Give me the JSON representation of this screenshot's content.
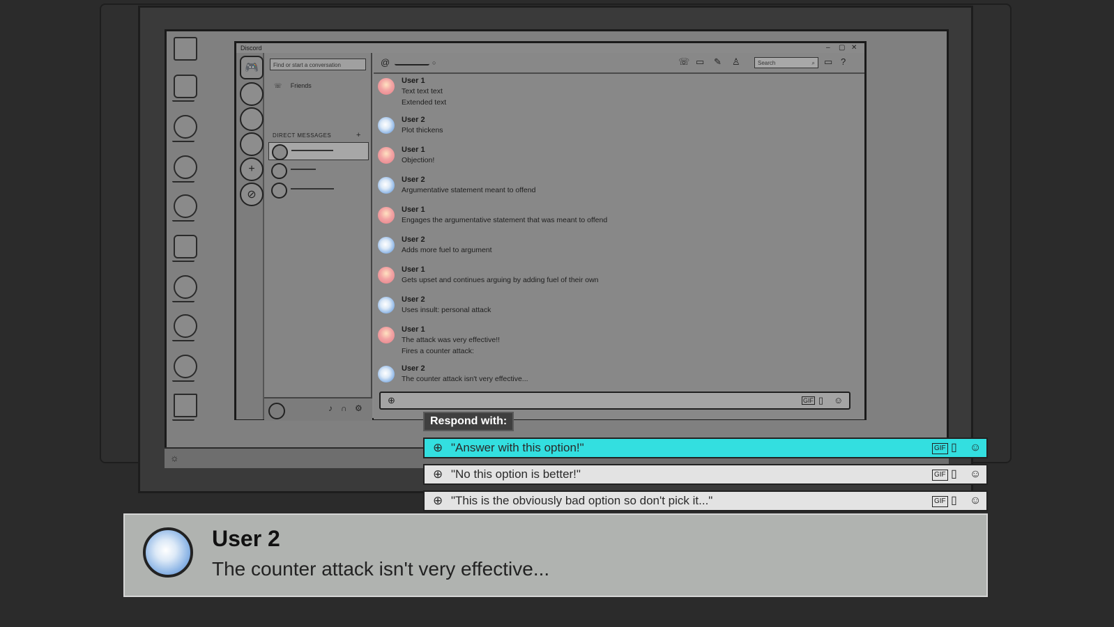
{
  "window": {
    "title": "Discord",
    "min": "–",
    "max": "▢",
    "close": "✕"
  },
  "dm_panel": {
    "search_placeholder": "Find or start a conversation",
    "friends_label": "Friends",
    "direct_messages_header": "DIRECT MESSAGES",
    "add_dm": "+"
  },
  "chat_header": {
    "at_symbol": "@",
    "search_placeholder": "Search"
  },
  "messages": [
    {
      "user": "User 1",
      "avatar": "pink",
      "lines": [
        "Text text text",
        "Extended text"
      ]
    },
    {
      "user": "User 2",
      "avatar": "blue",
      "lines": [
        "Plot thickens"
      ]
    },
    {
      "user": "User 1",
      "avatar": "pink",
      "lines": [
        "Objection!"
      ]
    },
    {
      "user": "User 2",
      "avatar": "blue",
      "lines": [
        "Argumentative statement meant to offend"
      ]
    },
    {
      "user": "User 1",
      "avatar": "pink",
      "lines": [
        "Engages the argumentative statement that was meant to offend"
      ]
    },
    {
      "user": "User 2",
      "avatar": "blue",
      "lines": [
        "Adds more fuel to argument"
      ]
    },
    {
      "user": "User 1",
      "avatar": "pink",
      "lines": [
        "Gets upset and continues arguing by adding fuel of their own"
      ]
    },
    {
      "user": "User 2",
      "avatar": "blue",
      "lines": [
        "Uses insult: personal attack"
      ]
    },
    {
      "user": "User 1",
      "avatar": "pink",
      "lines": [
        "The attack was very effective!!",
        "Fires a counter attack:"
      ]
    },
    {
      "user": "User 2",
      "avatar": "blue",
      "lines": [
        "The counter attack isn't very effective..."
      ]
    }
  ],
  "respond": {
    "label": "Respond with:",
    "options": [
      {
        "text": "\"Answer with this option!\"",
        "selected": true
      },
      {
        "text": "\"No this option is better!\"",
        "selected": false
      },
      {
        "text": "\"This is the obviously bad option so don't pick it...\"",
        "selected": false
      }
    ],
    "gif_label": "GIF"
  },
  "dialog": {
    "speaker": "User 2",
    "text": "The counter attack isn't very effective..."
  },
  "colors": {
    "selected_option": "#33dfe0",
    "option_bg": "#e3e3e3",
    "dialog_bg": "#b0b3b0"
  }
}
